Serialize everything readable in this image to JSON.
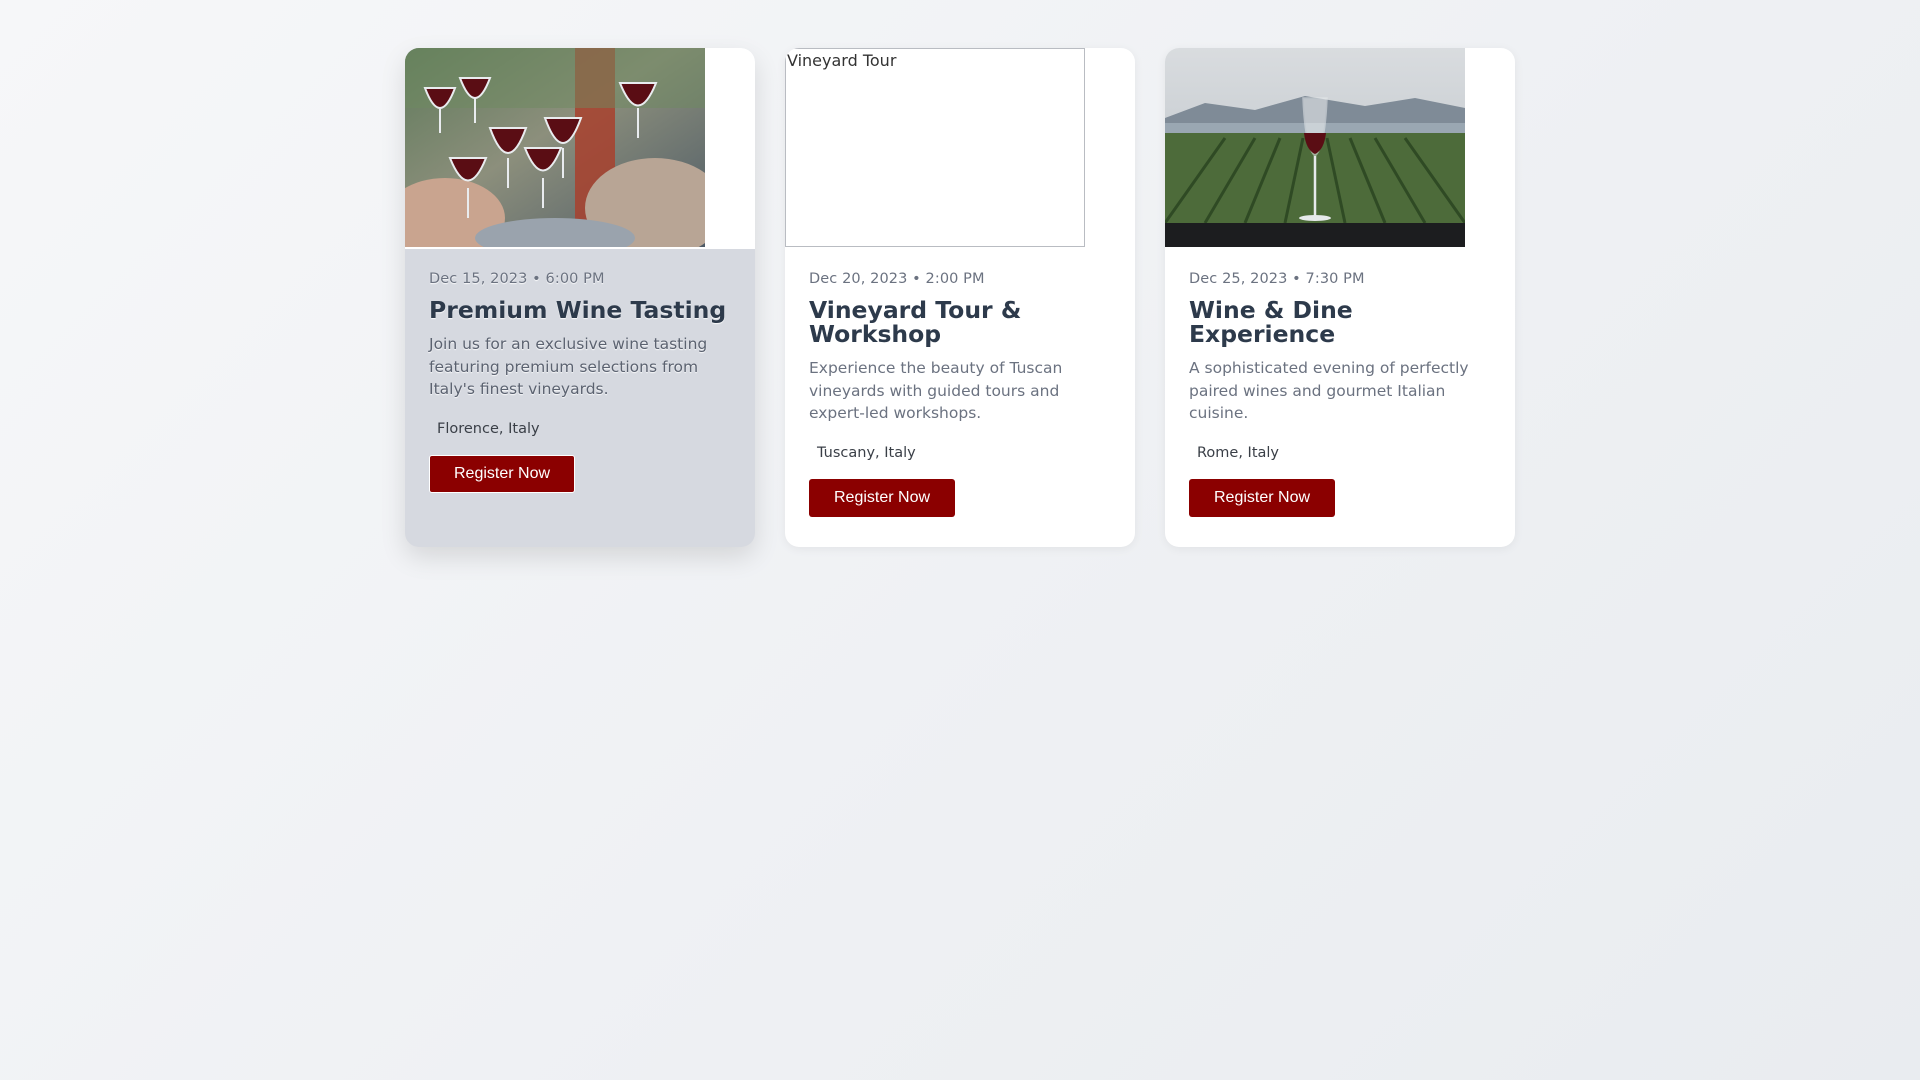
{
  "events": [
    {
      "image_alt": "Wine Tasting",
      "date": "Dec 15, 2023 • 6:00 PM",
      "title": "Premium Wine Tasting",
      "description": "Join us for an exclusive wine tasting featuring premium selections from Italy's finest vineyards.",
      "location": "Florence, Italy",
      "button_label": "Register Now"
    },
    {
      "image_alt": "Vineyard Tour",
      "date": "Dec 20, 2023 • 2:00 PM",
      "title": "Vineyard Tour & Workshop",
      "description": "Experience the beauty of Tuscan vineyards with guided tours and expert-led workshops.",
      "location": "Tuscany, Italy",
      "button_label": "Register Now"
    },
    {
      "image_alt": "Wine & Dine",
      "date": "Dec 25, 2023 • 7:30 PM",
      "title": "Wine & Dine Experience",
      "description": "A sophisticated evening of perfectly paired wines and gourmet Italian cuisine.",
      "location": "Rome, Italy",
      "button_label": "Register Now"
    }
  ],
  "colors": {
    "accent": "#8b0000",
    "title": "#2d3a4b",
    "muted": "#6b7280",
    "card": "#ffffff",
    "card_hover": "#d6d9e0"
  }
}
